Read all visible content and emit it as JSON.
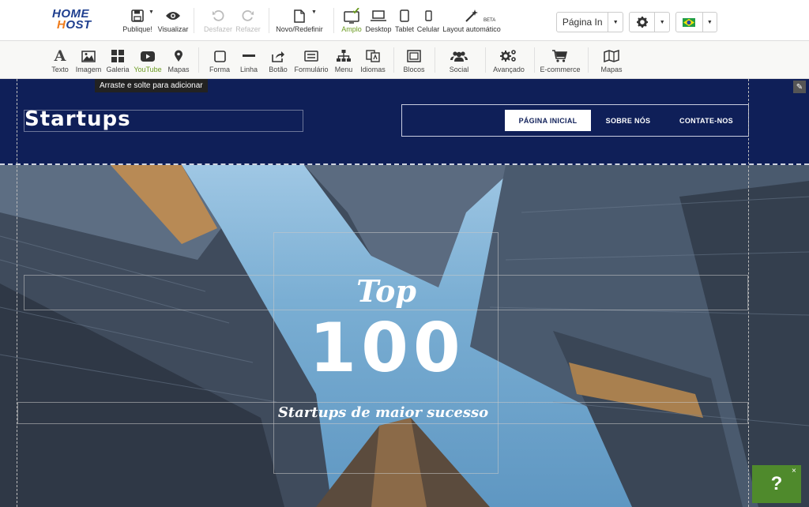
{
  "logo": {
    "line1": "HOME",
    "line2_prefix": "",
    "line2_o": "H",
    "line2_rest": "OST"
  },
  "topbar": {
    "publish": "Publique!",
    "preview": "Visualizar",
    "undo": "Desfazer",
    "redo": "Refazer",
    "new_reset": "Novo/Redefinir",
    "wide": "Amplo",
    "desktop": "Desktop",
    "tablet": "Tablet",
    "mobile": "Celular",
    "auto_layout": "Layout automático",
    "beta": "BETA",
    "page_select": "Página In"
  },
  "toolbar2": {
    "text": "Texto",
    "image": "Imagem",
    "gallery": "Galeria",
    "youtube": "YouTube",
    "maps": "Mapas",
    "shape": "Forma",
    "line": "Linha",
    "button": "Botão",
    "form": "Formulário",
    "menu": "Menu",
    "languages": "Idiomas",
    "blocks": "Blocos",
    "social": "Social",
    "advanced": "Avançado",
    "ecommerce": "E-commerce",
    "maps2": "Mapas",
    "tooltip": "Arraste e solte para adicionar"
  },
  "site": {
    "brand": "Startups",
    "nav": [
      "PÁGINA INICIAL",
      "SOBRE NÓS",
      "CONTATE-NOS"
    ],
    "hero_top": "Top",
    "hero_number": "100",
    "hero_subtitle": "Startups de maior sucesso"
  },
  "help": {
    "label": "?",
    "close": "×"
  },
  "colors": {
    "header": "#0f1f58",
    "accent_green": "#6a9a1f",
    "help_green": "#4f8a2c"
  }
}
